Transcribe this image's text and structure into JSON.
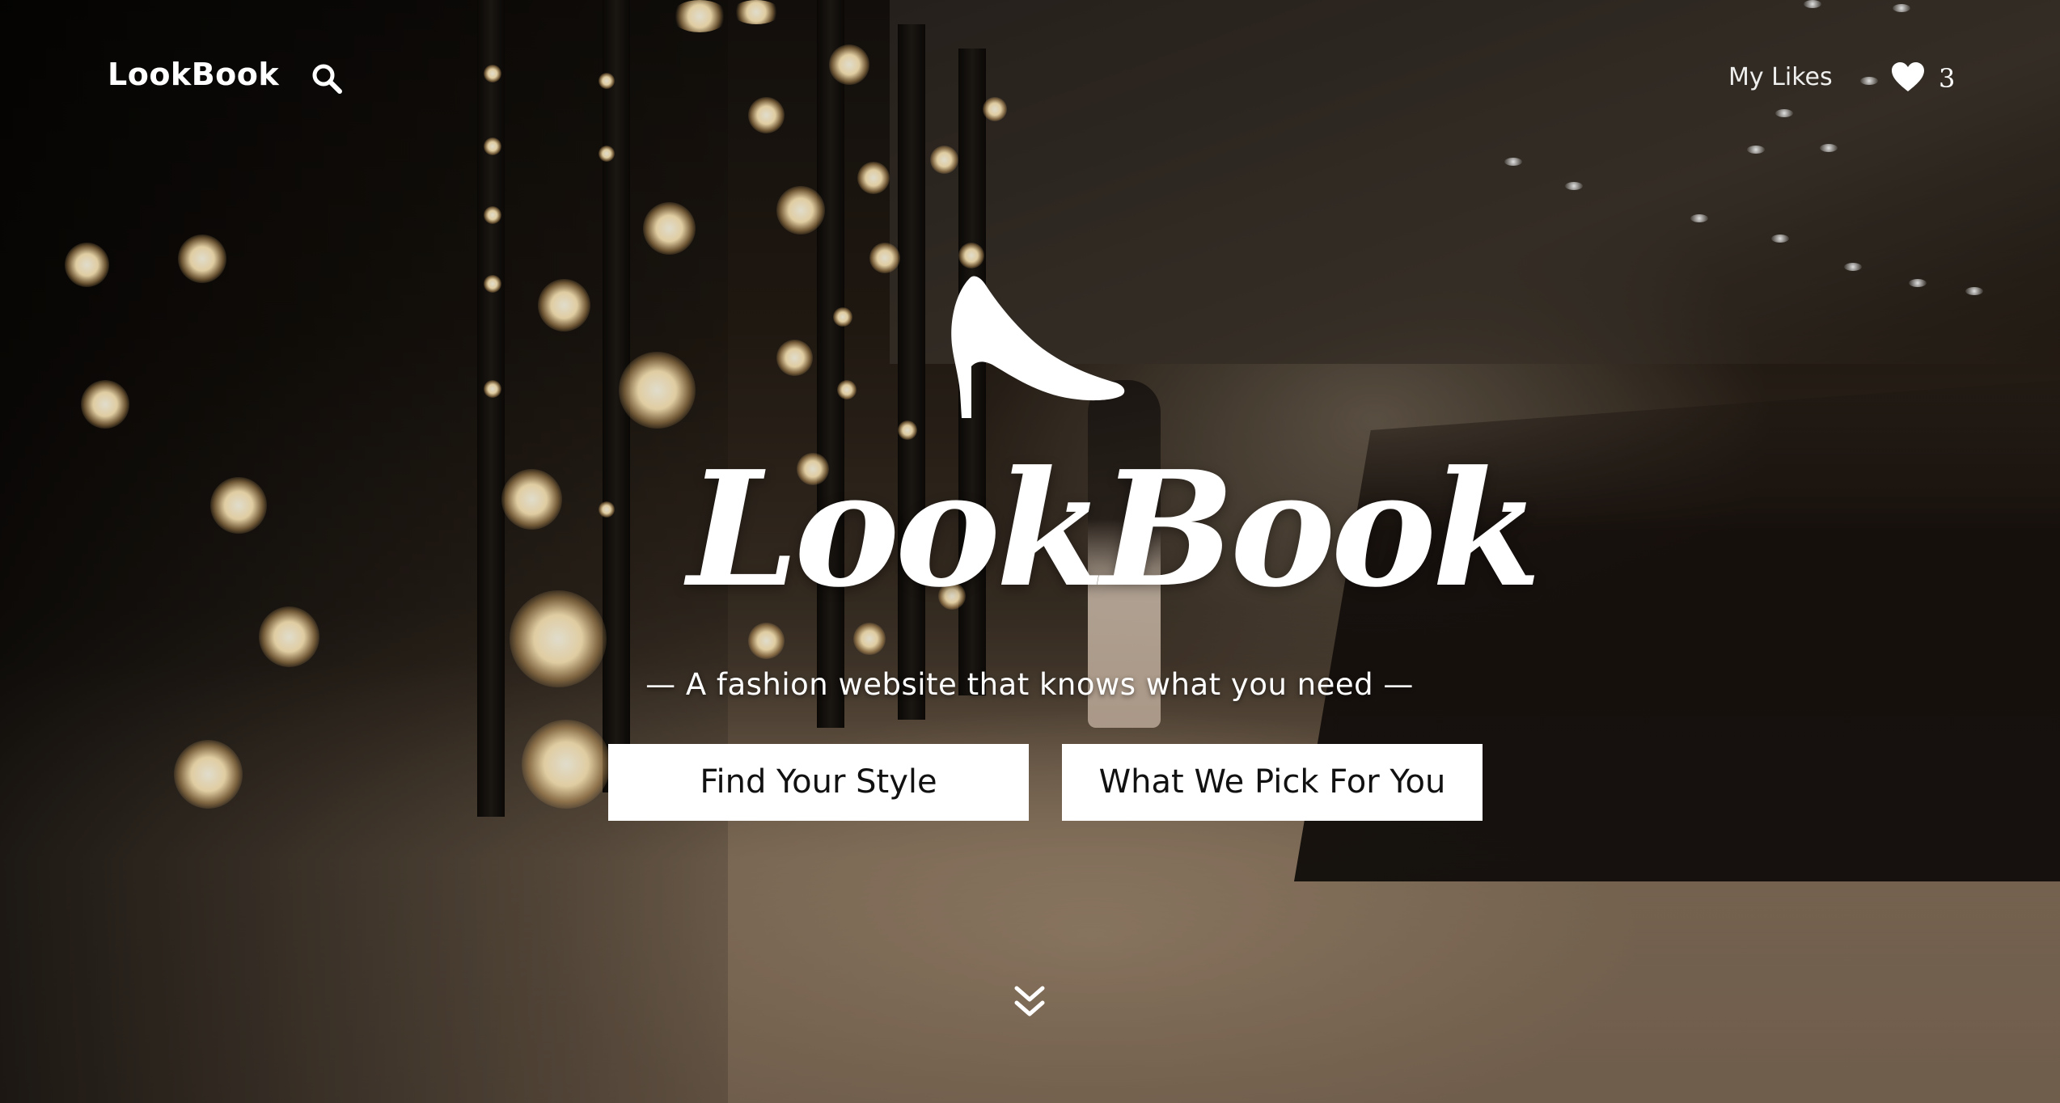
{
  "nav": {
    "brand": "LookBook",
    "search_icon": "search-icon",
    "likes_label": "My Likes",
    "likes_icon": "heart-icon",
    "likes_count": "3"
  },
  "hero": {
    "logo_icon": "high-heel-shoe-icon",
    "logo_text": "LookBook",
    "tagline": "— A fashion website that knows what you need —",
    "buttons": [
      {
        "label": "Find Your Style"
      },
      {
        "label": "What We Pick For You"
      }
    ],
    "scroll_icon": "double-chevron-down-icon"
  },
  "colors": {
    "button_background": "#ffffff",
    "button_text": "#111111",
    "text": "#ffffff"
  }
}
